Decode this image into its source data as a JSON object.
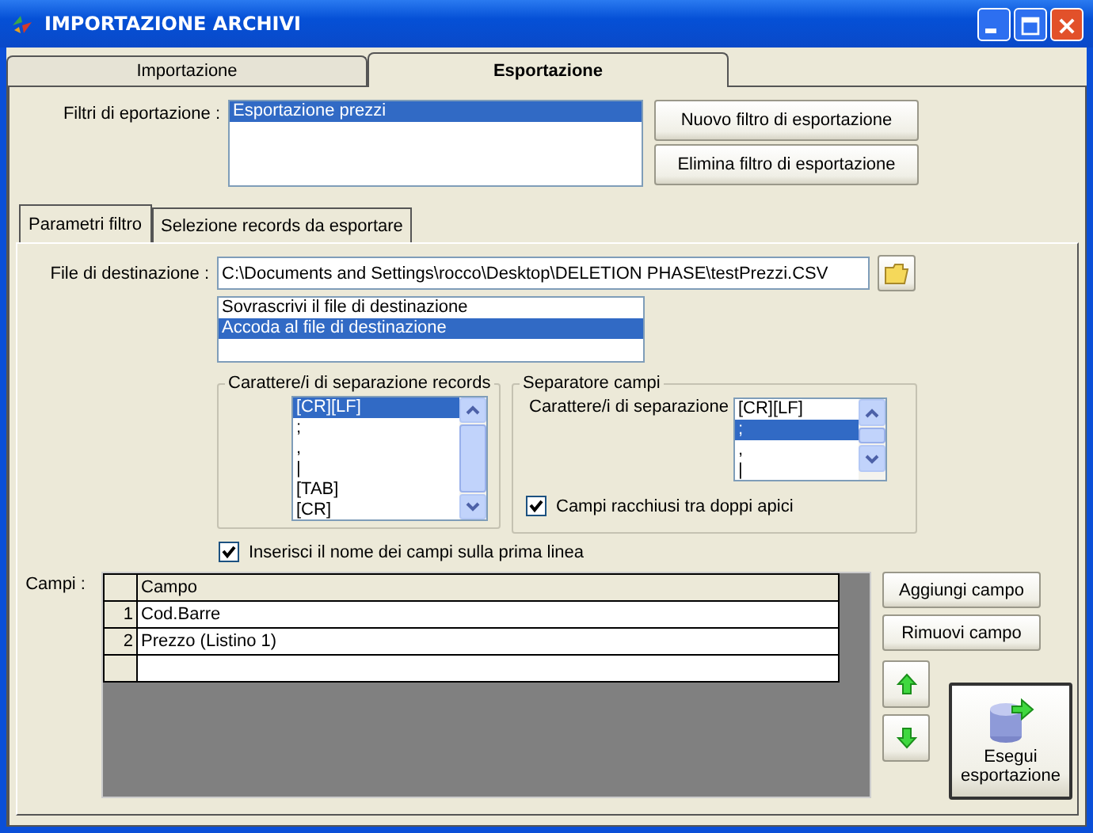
{
  "window": {
    "title": "IMPORTAZIONE ARCHIVI"
  },
  "tabs": [
    {
      "label": "Importazione",
      "selected": false
    },
    {
      "label": "Esportazione",
      "selected": true
    }
  ],
  "filters": {
    "label": "Filtri di eportazione :",
    "items": [
      {
        "label": "Esportazione prezzi",
        "selected": true
      }
    ],
    "buttons": [
      "Nuovo filtro di esportazione",
      "Elimina filtro di esportazione"
    ]
  },
  "subtabs": [
    {
      "label": "Parametri filtro",
      "selected": true
    },
    {
      "label": "Selezione records da esportare",
      "selected": false
    }
  ],
  "destination": {
    "label": "File di destinazione :",
    "value": "C:\\Documents and Settings\\rocco\\Desktop\\DELETION PHASE\\testPrezzi.CSV"
  },
  "write_mode": [
    {
      "label": "Sovrascrivi il file di destinazione",
      "selected": false
    },
    {
      "label": "Accoda al file di destinazione",
      "selected": true
    }
  ],
  "record_separator": {
    "title": "Carattere/i di separazione records",
    "items": [
      {
        "label": "[CR][LF]",
        "selected": true
      },
      {
        "label": ";",
        "selected": false
      },
      {
        "label": ",",
        "selected": false
      },
      {
        "label": "|",
        "selected": false
      },
      {
        "label": "[TAB]",
        "selected": false
      },
      {
        "label": "[CR]",
        "selected": false
      }
    ]
  },
  "field_separator": {
    "title": "Separatore campi",
    "label": "Carattere/i di separazione",
    "items": [
      {
        "label": "[CR][LF]",
        "selected": false
      },
      {
        "label": ";",
        "selected": true
      },
      {
        "label": ",",
        "selected": false
      },
      {
        "label": "|",
        "selected": false
      }
    ],
    "quoted": {
      "label": "Campi racchiusi tra doppi apici",
      "checked": true
    }
  },
  "header_row": {
    "label": "Inserisci il nome dei campi sulla prima linea",
    "checked": true
  },
  "fields": {
    "label": "Campi :",
    "columns": [
      "Campo"
    ],
    "rows": [
      {
        "number": "1",
        "name": "Cod.Barre"
      },
      {
        "number": "2",
        "name": "Prezzo (Listino 1)"
      }
    ]
  },
  "field_buttons": [
    "Aggiungi campo",
    "Rimuovi campo"
  ],
  "run_button": {
    "label": "Esegui esportazione"
  }
}
